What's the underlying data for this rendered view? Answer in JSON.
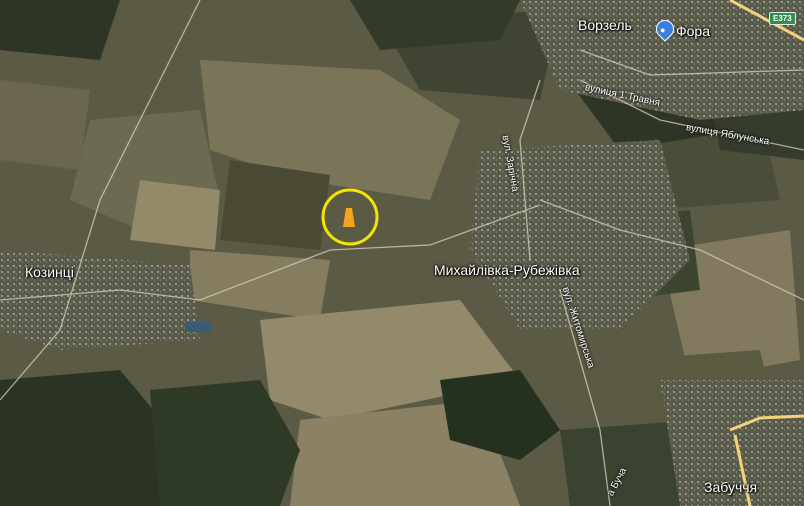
{
  "map": {
    "places": {
      "vorzel": "Ворзель",
      "fora": "Фора",
      "kozyntsi": "Козинці",
      "mykhailivka": "Михайлівка-Рубежівка",
      "zabuchchia": "Забуччя"
    },
    "streets": {
      "pervogo_travnia": "вулиця 1 Травня",
      "yablunska": "вулиця Яблунська",
      "zarichna": "вул. Зарічна",
      "zhytomyrska": "вул. Житомирська",
      "bucha": "а Буча"
    },
    "road_shield": "E373",
    "poi_icon": "shopping-bag-icon",
    "colors": {
      "marker_ring": "#f2e600",
      "marker_fill": "#f5a51a",
      "road": "#f4d27a",
      "poi": "#3a7ee0",
      "shield": "#2f8f4f"
    }
  }
}
